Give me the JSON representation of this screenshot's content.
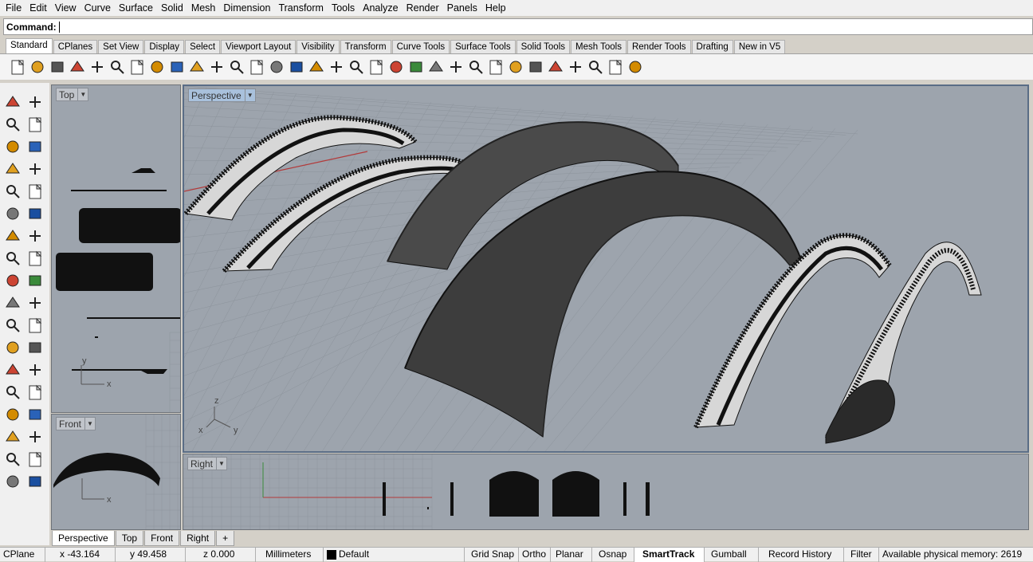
{
  "menu": [
    "File",
    "Edit",
    "View",
    "Curve",
    "Surface",
    "Solid",
    "Mesh",
    "Dimension",
    "Transform",
    "Tools",
    "Analyze",
    "Render",
    "Panels",
    "Help"
  ],
  "command": {
    "label": "Command:",
    "value": ""
  },
  "toolbar_tabs": [
    "Standard",
    "CPlanes",
    "Set View",
    "Display",
    "Select",
    "Viewport Layout",
    "Visibility",
    "Transform",
    "Curve Tools",
    "Surface Tools",
    "Solid Tools",
    "Mesh Tools",
    "Render Tools",
    "Drafting",
    "New in V5"
  ],
  "active_toolbar_tab": "Standard",
  "toolbar_icons": [
    "new-icon",
    "open-icon",
    "save-icon",
    "print-icon",
    "import-icon",
    "cut-icon",
    "copy-icon",
    "paste-icon",
    "undo-icon",
    "pan-icon",
    "rotate-icon",
    "zoom-icon",
    "zoom-window-icon",
    "zoom-extents-icon",
    "zoom-selected-icon",
    "rotate-view-icon",
    "four-view-icon",
    "car-icon",
    "grid-icon",
    "circle-icon",
    "osnap-icon",
    "light-icon",
    "lock-icon",
    "layer-icon",
    "color-icon",
    "shaded-icon",
    "rendered-icon",
    "render-icon",
    "dim-icon",
    "gear-icon",
    "snap-icon",
    "help-icon"
  ],
  "left_icons": [
    "select-icon",
    "point-icon",
    "polyline-icon",
    "curve-icon",
    "circle-icon",
    "ellipse-icon",
    "arc-icon",
    "rectangle-icon",
    "polygon-icon",
    "fillet-curve-icon",
    "surface-icon",
    "loft-icon",
    "box-icon",
    "sphere-icon",
    "cylinder-icon",
    "mesh-icon",
    "explode-icon",
    "trim-icon",
    "move-icon",
    "split-icon",
    "boolean-icon",
    "group-icon",
    "fillet-icon",
    "chamfer-icon",
    "text-icon",
    "dimension-icon",
    "array-icon",
    "mirror-icon",
    "block-icon",
    "hatch-icon",
    "grid-icon",
    "align-icon",
    "analyze-icon",
    "check-icon",
    "render-shape-icon",
    "paint-icon"
  ],
  "viewports": {
    "top": "Top",
    "perspective": "Perspective",
    "front": "Front",
    "right": "Right"
  },
  "axes": {
    "x": "x",
    "y": "y",
    "z": "z"
  },
  "bottom_tabs": [
    "Perspective",
    "Top",
    "Front",
    "Right",
    "+"
  ],
  "status": {
    "cplane": "CPlane",
    "x": "x -43.164",
    "y": "y 49.458",
    "z": "z 0.000",
    "units": "Millimeters",
    "layer": "Default",
    "grid_snap": "Grid Snap",
    "ortho": "Ortho",
    "planar": "Planar",
    "osnap": "Osnap",
    "smarttrack": "SmartTrack",
    "gumball": "Gumball",
    "record_history": "Record History",
    "filter": "Filter",
    "memory": "Available physical memory: 2619"
  },
  "colors": {
    "viewport_bg": "#9da4ad",
    "active_label": "#a9c1dc",
    "grid": "#8c939b",
    "x_axis": "#b23a3a",
    "y_axis": "#3a8a3a"
  }
}
